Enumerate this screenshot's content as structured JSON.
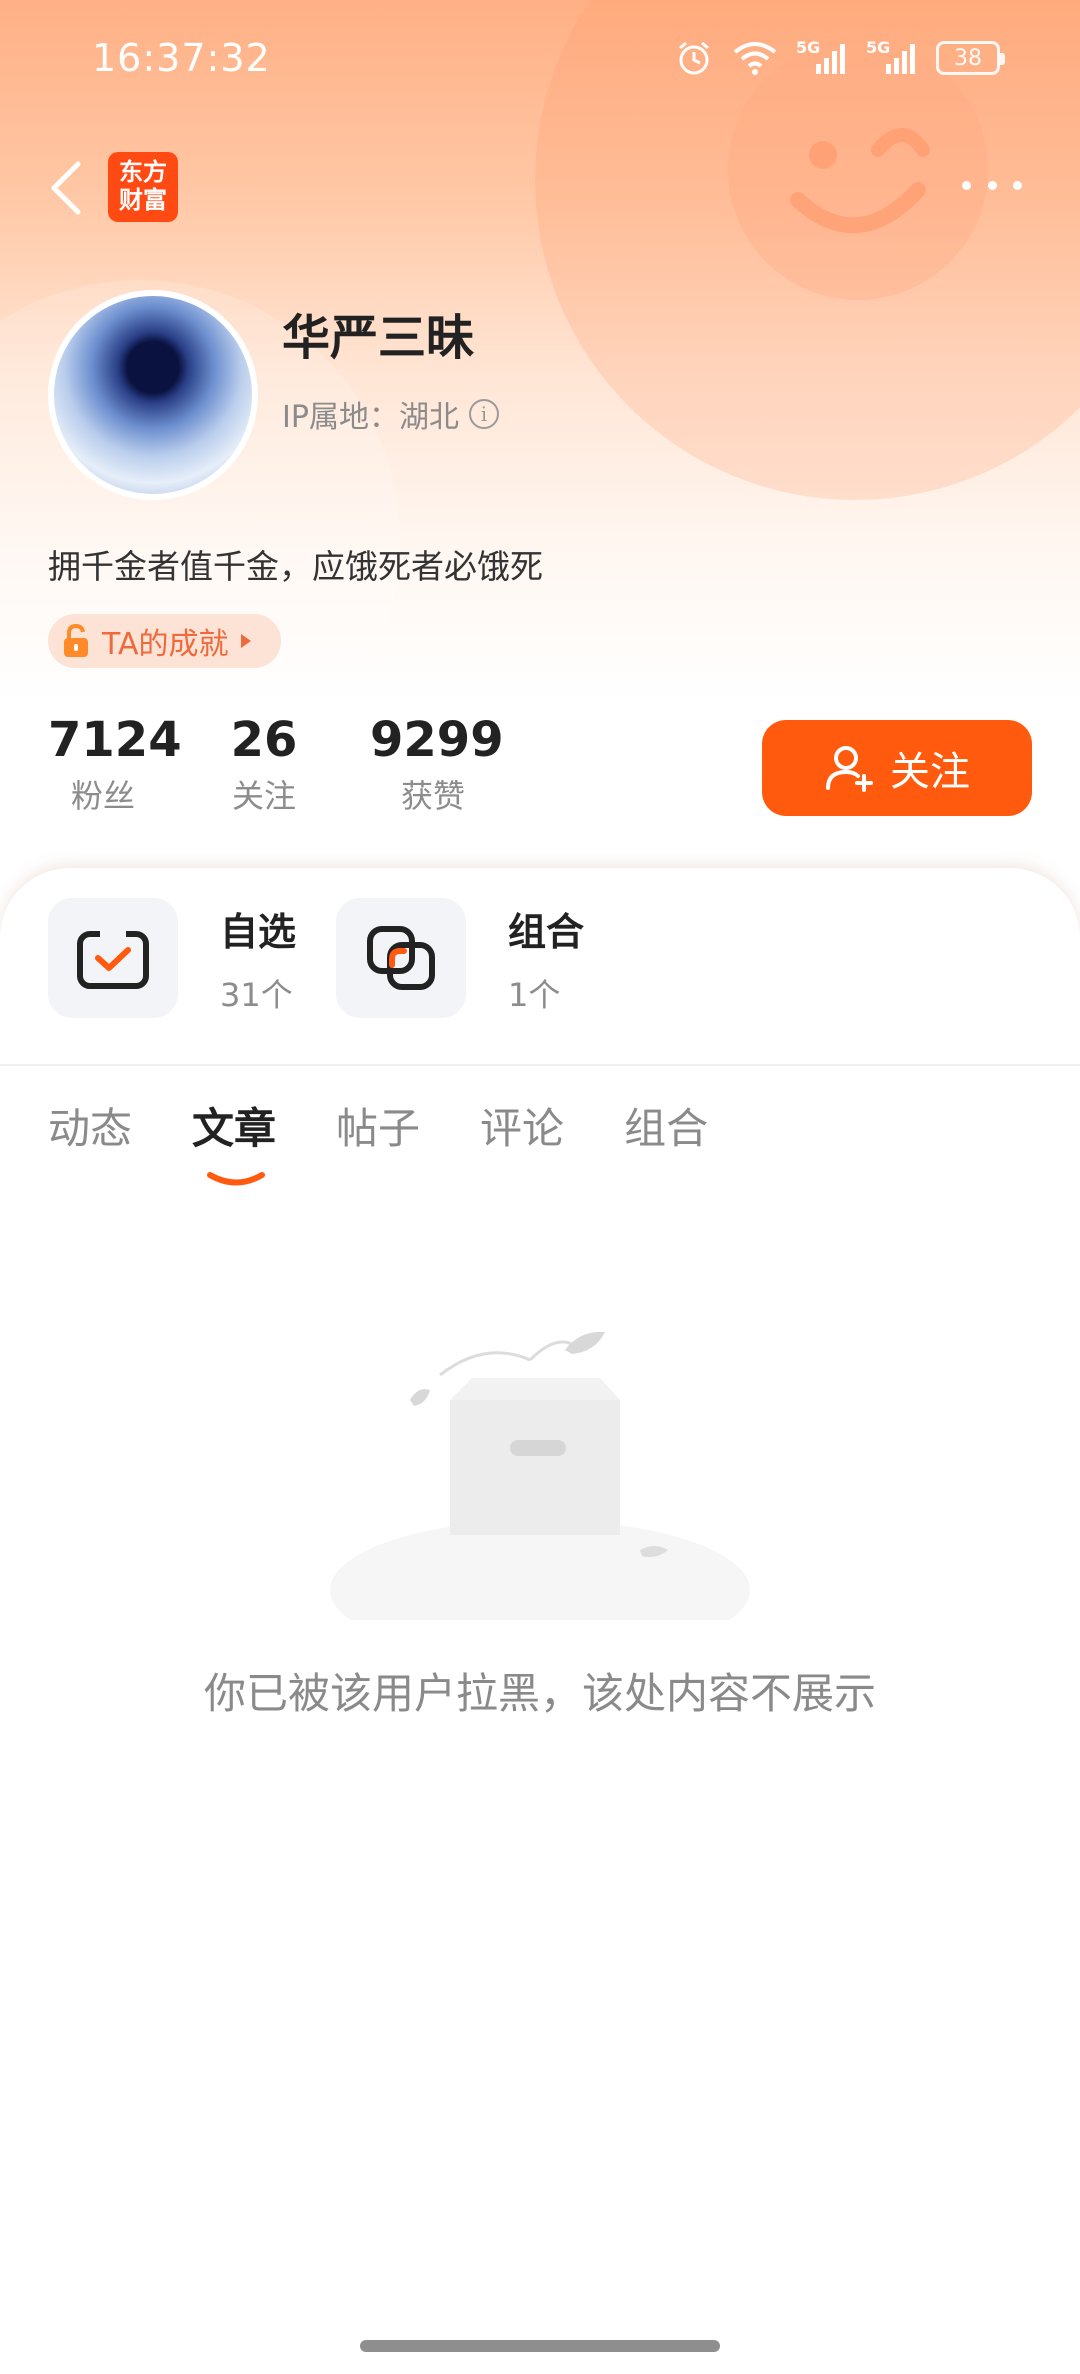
{
  "status_bar": {
    "time": "16:37:32",
    "network_1": "5G",
    "network_2": "5G",
    "battery": "38"
  },
  "nav": {
    "logo_line1": "东方",
    "logo_line2": "财富"
  },
  "profile": {
    "name": "华严三昧",
    "ip_label": "IP属地：湖北",
    "bio": "拥千金者值千金，应饿死者必饿死",
    "achievement_label": "TA的成就"
  },
  "stats": [
    {
      "value": "7124",
      "label": "粉丝"
    },
    {
      "value": "26",
      "label": "关注"
    },
    {
      "value": "9299",
      "label": "获赞"
    }
  ],
  "follow_button": "关注",
  "quick_entries": [
    {
      "title": "自选",
      "count": "31个"
    },
    {
      "title": "组合",
      "count": "1个"
    }
  ],
  "tabs": [
    {
      "label": "动态"
    },
    {
      "label": "文章",
      "active": true
    },
    {
      "label": "帖子"
    },
    {
      "label": "评论"
    },
    {
      "label": "组合"
    }
  ],
  "empty_message": "你已被该用户拉黑，该处内容不展示",
  "colors": {
    "accent": "#ff5a0d",
    "logo_bg": "#ff4a14",
    "achievement_bg": "#fde2d6",
    "achievement_text": "#ef6a3b"
  }
}
